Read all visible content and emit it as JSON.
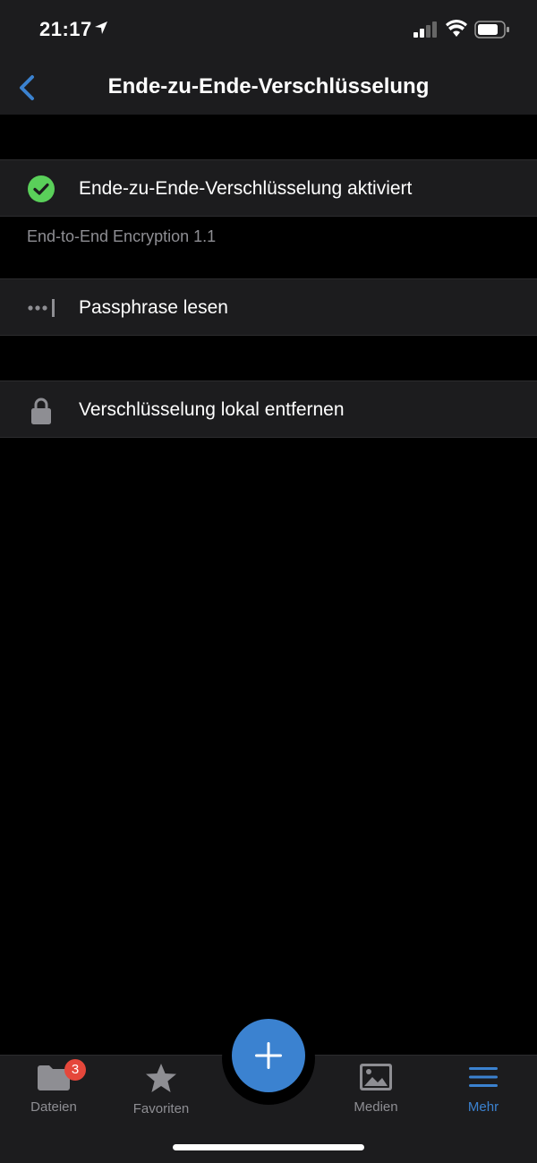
{
  "status_bar": {
    "time": "21:17"
  },
  "nav": {
    "title": "Ende-zu-Ende-Verschlüsselung"
  },
  "rows": [
    {
      "label": "Ende-zu-Ende-Verschlüsselung aktiviert",
      "icon": "check-circle-icon"
    },
    {
      "label": "Passphrase lesen",
      "icon": "passphrase-icon"
    },
    {
      "label": "Verschlüsselung lokal entfernen",
      "icon": "lock-icon"
    }
  ],
  "version_text": "End-to-End Encryption 1.1",
  "tabbar": {
    "tabs": [
      {
        "label": "Dateien",
        "icon": "folder-icon",
        "badge": "3"
      },
      {
        "label": "Favoriten",
        "icon": "star-icon"
      },
      {
        "label": "Medien",
        "icon": "image-icon"
      },
      {
        "label": "Mehr",
        "icon": "menu-icon",
        "active": true
      }
    ]
  },
  "colors": {
    "accent": "#3b82d0",
    "success": "#5ad05a",
    "badge": "#e5473b",
    "background": "#000000",
    "surface": "#1c1c1e"
  }
}
